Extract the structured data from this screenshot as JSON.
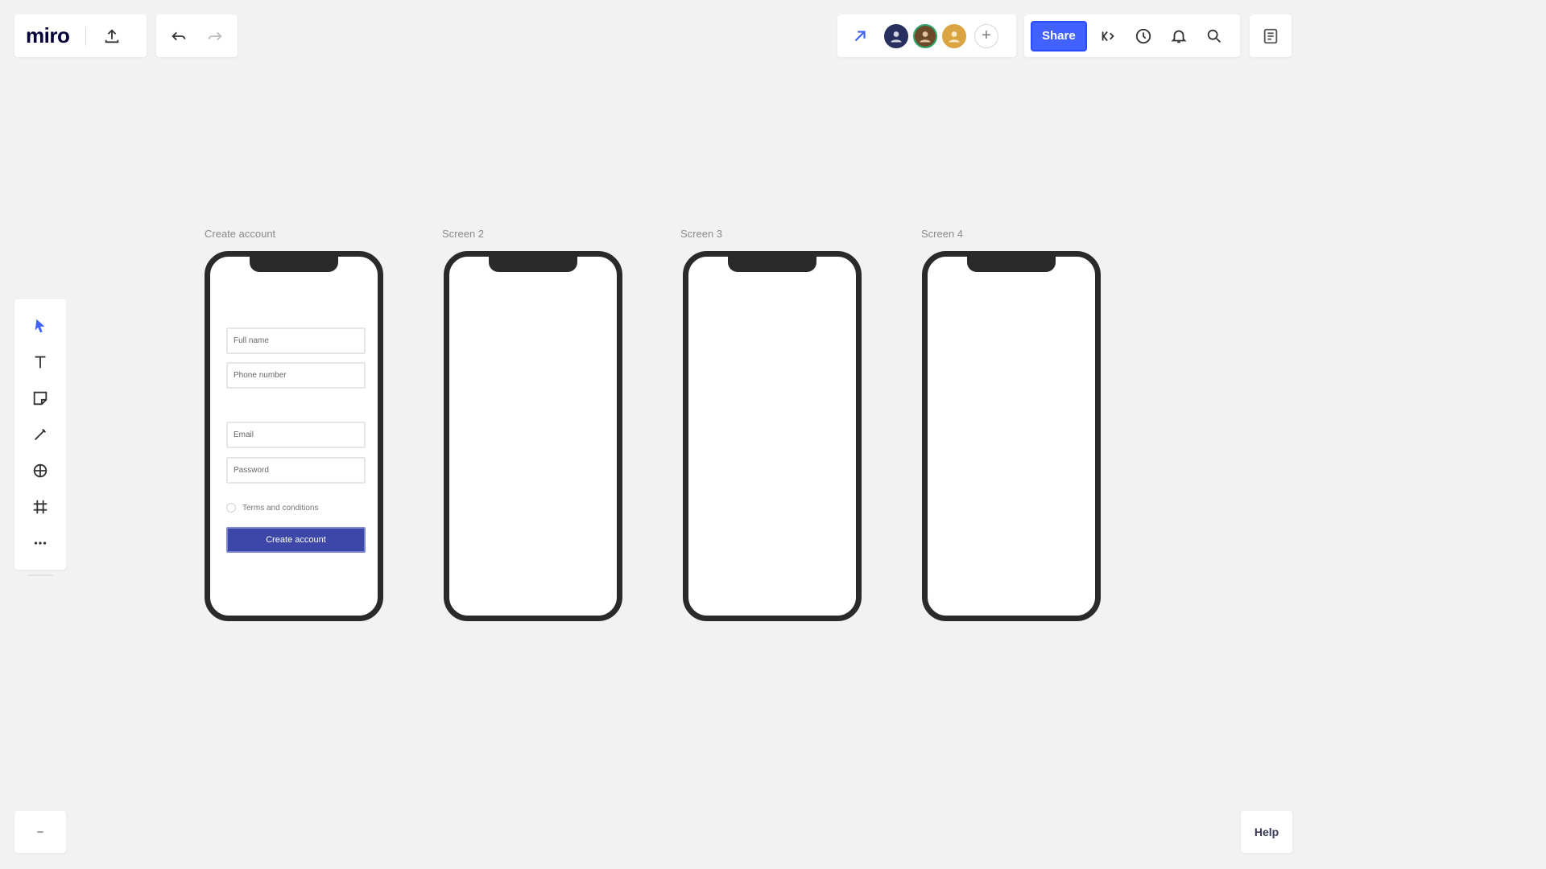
{
  "app": {
    "logo_text": "miro"
  },
  "toolbar_top_left": {
    "icons": [
      "upload-icon",
      "undo-icon",
      "redo-icon"
    ]
  },
  "collaboration": {
    "icons": [
      "reaction-arrow-icon",
      "add-collaborator-icon"
    ],
    "avatars": [
      {
        "initials": "",
        "color": "#27305e"
      },
      {
        "initials": "",
        "color": "#6b4a2a"
      },
      {
        "initials": "",
        "color": "#d9a441"
      }
    ],
    "plus_label": "+"
  },
  "actions": {
    "share_label": "Share",
    "icons": [
      "emoji-icon",
      "timer-icon",
      "notification-bell-icon",
      "search-icon"
    ]
  },
  "panels": {
    "icons": [
      "panel-list-icon"
    ]
  },
  "left_toolbar": {
    "tools": [
      {
        "name": "select",
        "icon": "cursor-icon",
        "active": true
      },
      {
        "name": "text",
        "icon": "text-icon"
      },
      {
        "name": "sticky-note",
        "icon": "sticky-note-icon"
      },
      {
        "name": "pen",
        "icon": "pen-icon"
      },
      {
        "name": "shapes",
        "icon": "shapes-icon"
      },
      {
        "name": "frame",
        "icon": "frame-icon"
      },
      {
        "name": "more",
        "icon": "more-icon"
      }
    ]
  },
  "canvas": {
    "frames": [
      {
        "title": "Create account",
        "fields": [
          "Full name",
          "Phone number",
          "Email",
          "Password"
        ],
        "checkbox_label": "Terms and conditions",
        "button_label": "Create account"
      },
      {
        "title": "Screen 2"
      },
      {
        "title": "Screen 3"
      },
      {
        "title": "Screen 4"
      }
    ]
  },
  "bottom": {
    "frames_toggle": "icon",
    "help_label": "Help"
  },
  "colors": {
    "accent": "#4262ff",
    "primary_button": "#3d47a8",
    "canvas_bg": "#f2f2f2",
    "phone_bezel": "#2a2a2a"
  }
}
